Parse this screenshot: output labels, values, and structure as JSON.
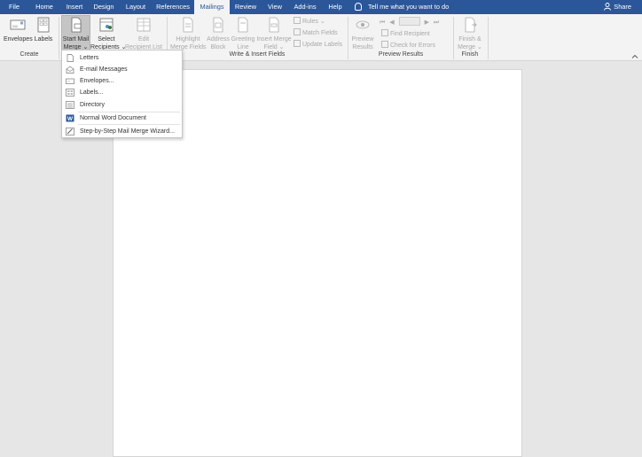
{
  "tabs": [
    {
      "label": "File",
      "active": false
    },
    {
      "label": "Home",
      "active": false
    },
    {
      "label": "Insert",
      "active": false
    },
    {
      "label": "Design",
      "active": false
    },
    {
      "label": "Layout",
      "active": false
    },
    {
      "label": "References",
      "active": false
    },
    {
      "label": "Mailings",
      "active": true
    },
    {
      "label": "Review",
      "active": false
    },
    {
      "label": "View",
      "active": false
    },
    {
      "label": "Add-ins",
      "active": false
    },
    {
      "label": "Help",
      "active": false
    }
  ],
  "tell_me": "Tell me what you want to do",
  "share": "Share",
  "ribbon": {
    "create": {
      "label": "Create",
      "envelopes": "Envelopes",
      "labels": "Labels"
    },
    "start": {
      "start_mail_merge_line1": "Start Mail",
      "start_mail_merge_line2": "Merge",
      "select_recipients_line1": "Select",
      "select_recipients_line2": "Recipients",
      "edit_recipient_list_line1": "Edit",
      "edit_recipient_list_line2": "Recipient List"
    },
    "write_insert": {
      "label": "Write & Insert Fields",
      "highlight_line1": "Highlight",
      "highlight_line2": "Merge Fields",
      "address_line1": "Address",
      "address_line2": "Block",
      "greeting_line1": "Greeting",
      "greeting_line2": "Line",
      "insert_line1": "Insert Merge",
      "insert_line2": "Field",
      "rules": "Rules",
      "match_fields": "Match Fields",
      "update_labels": "Update Labels"
    },
    "preview": {
      "label": "Preview Results",
      "preview_line1": "Preview",
      "preview_line2": "Results",
      "find_recipient": "Find Recipient",
      "check_errors": "Check for Errors"
    },
    "finish": {
      "label": "Finish",
      "finish_line1": "Finish &",
      "finish_line2": "Merge"
    }
  },
  "menu": {
    "items": [
      {
        "label": "Letters",
        "icon": "letter-icon"
      },
      {
        "label": "E-mail Messages",
        "icon": "email-icon"
      },
      {
        "label": "Envelopes...",
        "icon": "envelope-icon"
      },
      {
        "label": "Labels...",
        "icon": "labels-icon"
      },
      {
        "label": "Directory",
        "icon": "directory-icon"
      },
      {
        "label": "Normal Word Document",
        "icon": "word-document-icon"
      },
      {
        "label": "Step-by-Step Mail Merge Wizard...",
        "icon": "wizard-icon"
      }
    ]
  },
  "colors": {
    "tab_bar": "#2b579a",
    "ribbon": "#f3f3f3",
    "workspace": "#e6e6e6"
  }
}
